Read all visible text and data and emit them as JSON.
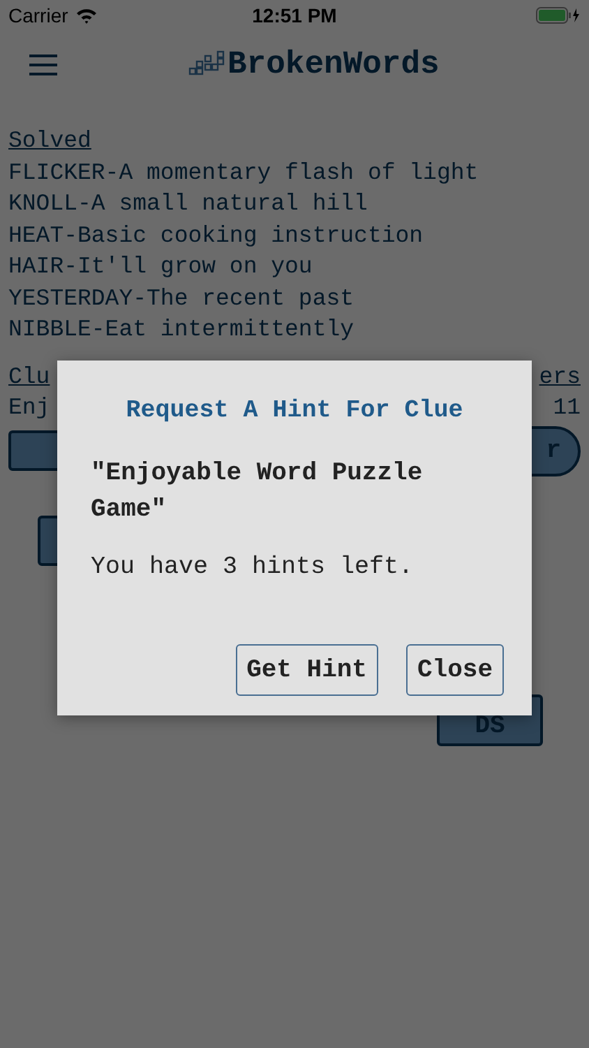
{
  "status_bar": {
    "carrier": "Carrier",
    "time": "12:51 PM"
  },
  "app_bar": {
    "title": "BrokenWords"
  },
  "solved": {
    "heading": "Solved",
    "items": [
      "FLICKER-A momentary flash of light",
      "KNOLL-A small natural hill",
      "HEAT-Basic cooking instruction",
      "HAIR-It'll grow on you",
      "YESTERDAY-The recent past",
      "NIBBLE-Eat intermittently"
    ]
  },
  "clue": {
    "heading": "Clu",
    "heading_right": "ers",
    "text": "Enj",
    "count": "11"
  },
  "buttons_row": {
    "right_label": "r"
  },
  "lower_button": {
    "label": "DS"
  },
  "dialog": {
    "title": "Request A Hint For Clue",
    "clue": "\"Enjoyable Word Puzzle Game\"",
    "message": "You have 3 hints left.",
    "buttons": [
      "Get Hint",
      "Close"
    ]
  }
}
